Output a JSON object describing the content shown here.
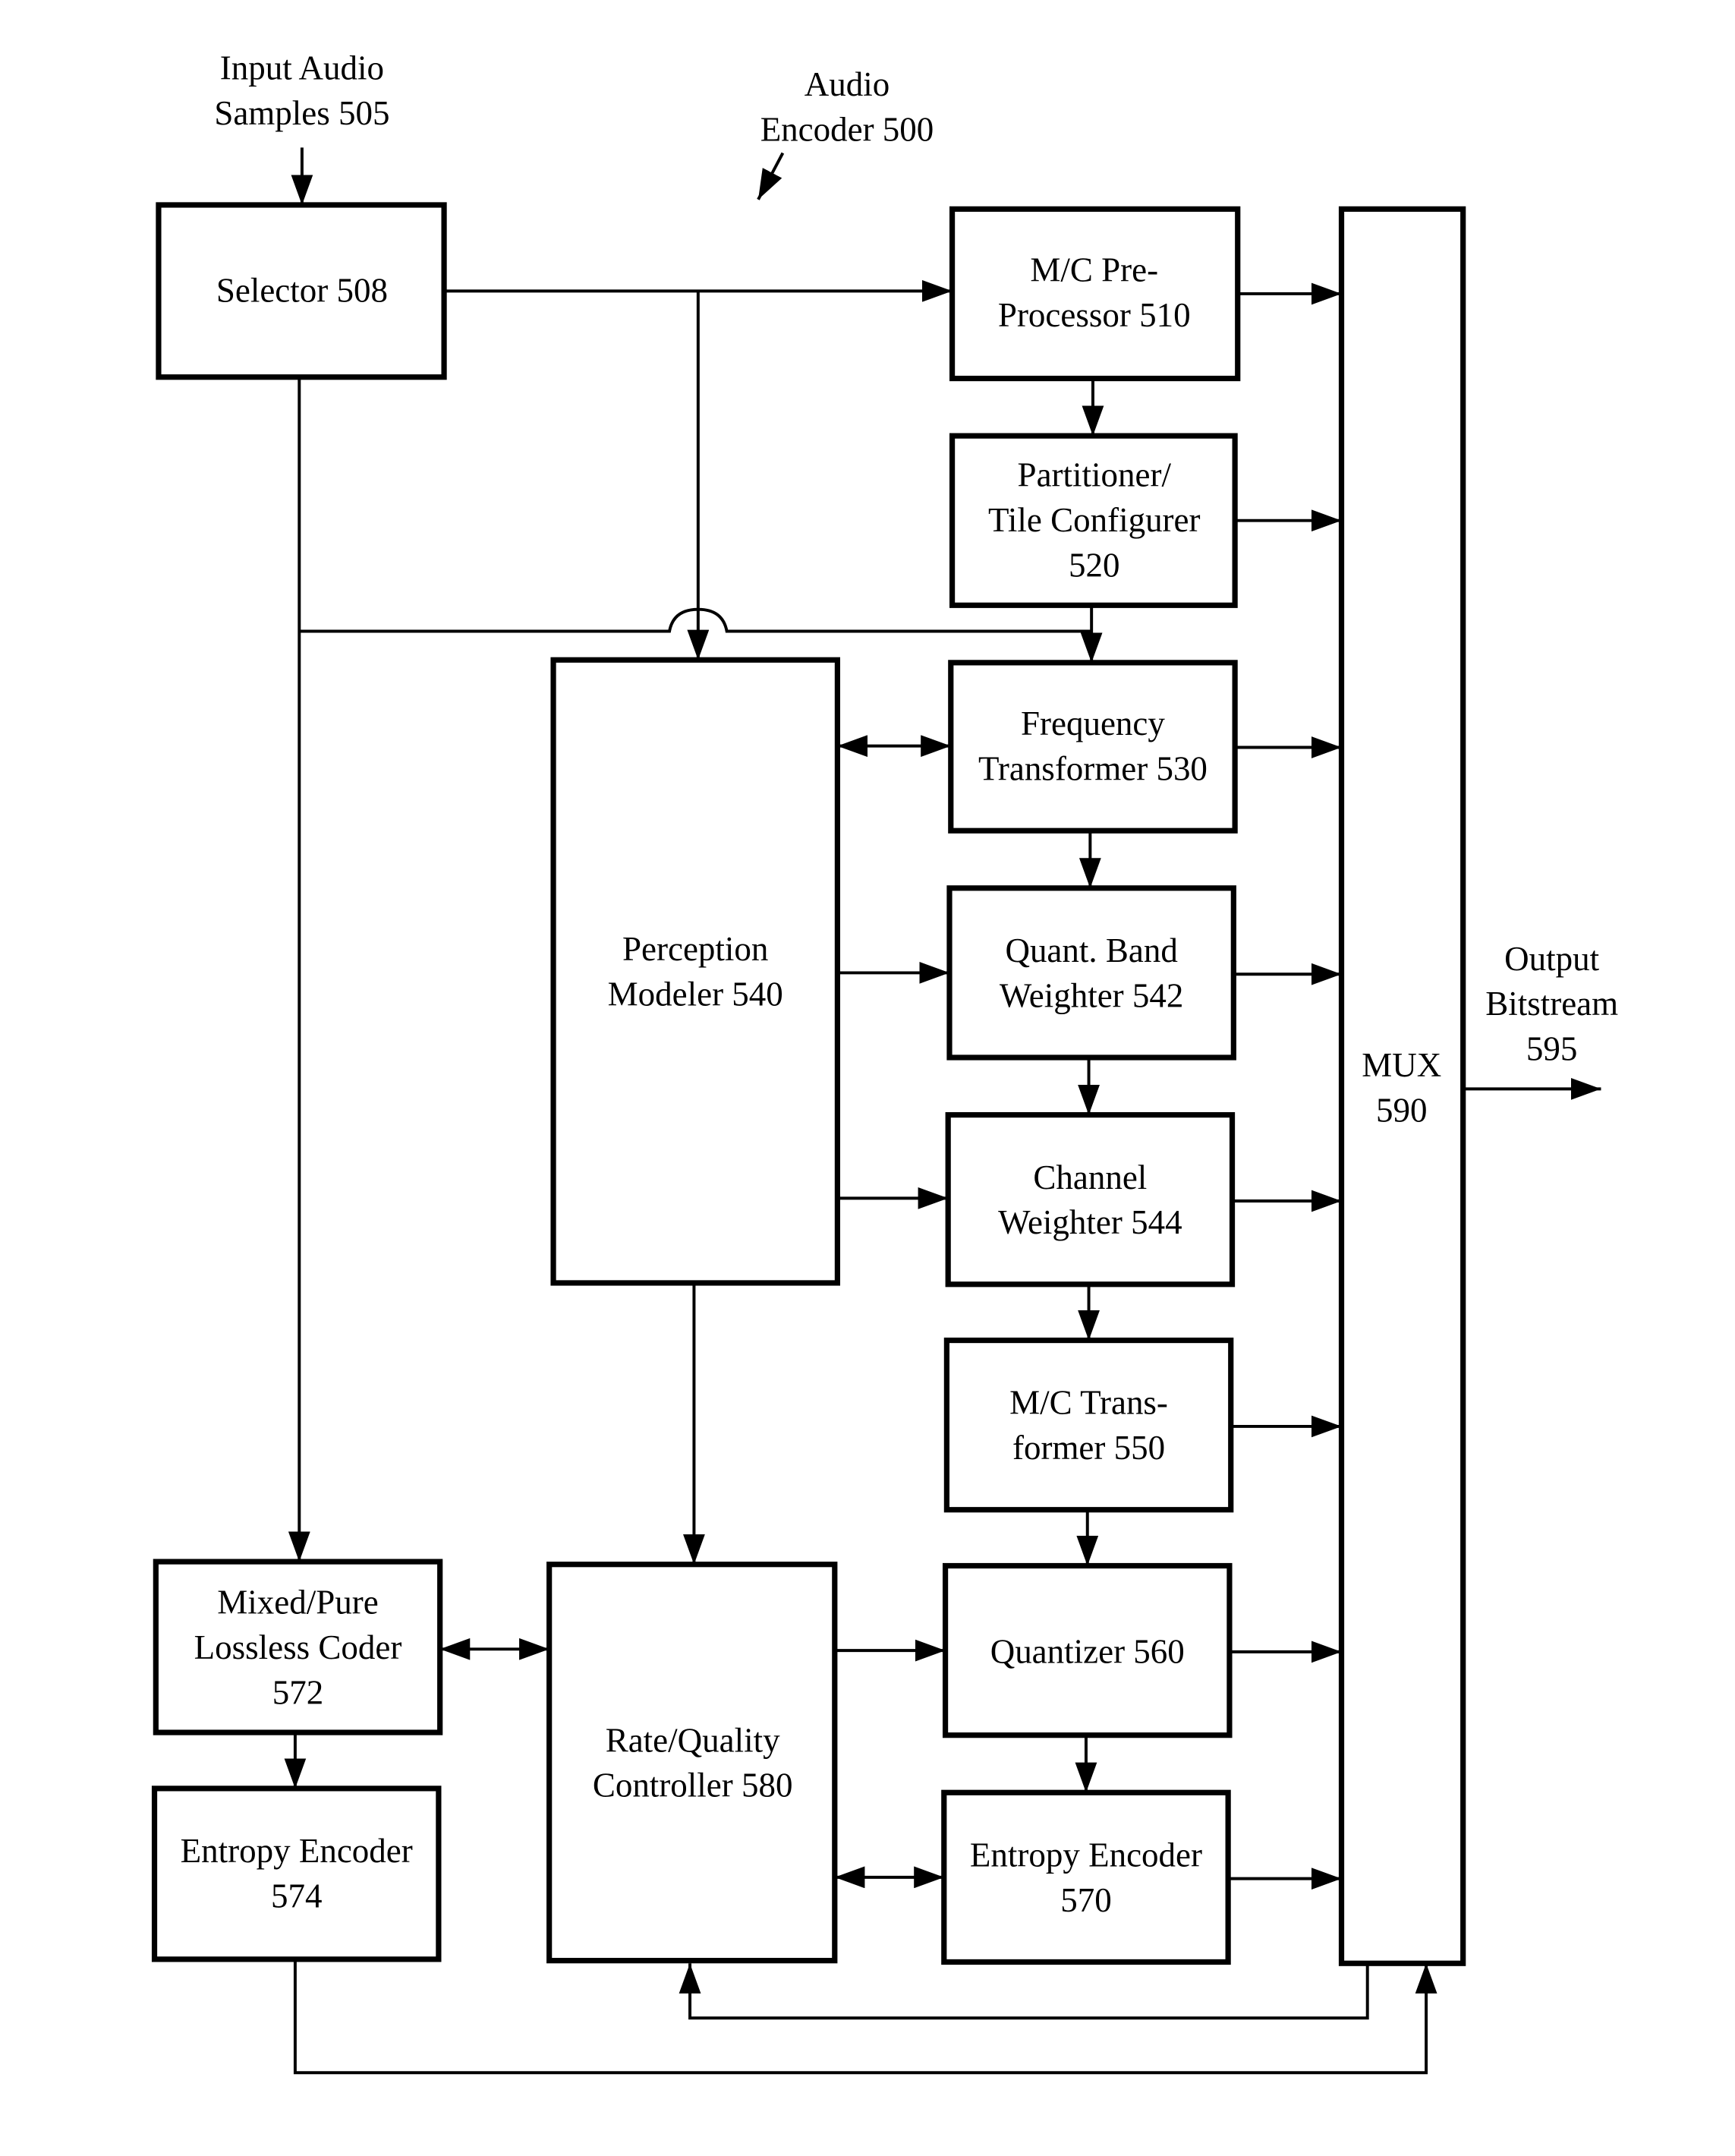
{
  "diagram": {
    "title": [
      "Audio",
      "Encoder 500"
    ],
    "input_label": [
      "Input Audio",
      "Samples 505"
    ],
    "output_label": [
      "Output",
      "Bitstream",
      "595"
    ],
    "blocks": {
      "selector": [
        "Selector 508"
      ],
      "mc_preprocessor": [
        "M/C Pre-",
        "Processor 510"
      ],
      "partitioner": [
        "Partitioner/",
        "Tile Configurer",
        "520"
      ],
      "freq_transformer": [
        "Frequency",
        "Transformer 530"
      ],
      "perception_modeler": [
        "Perception",
        "Modeler 540"
      ],
      "quant_band_weighter": [
        "Quant. Band",
        "Weighter 542"
      ],
      "channel_weighter": [
        "Channel",
        "Weighter 544"
      ],
      "mc_transformer": [
        "M/C Trans-",
        "former 550"
      ],
      "quantizer": [
        "Quantizer 560"
      ],
      "entropy_encoder_570": [
        "Entropy Encoder",
        "570"
      ],
      "lossless_coder": [
        "Mixed/Pure",
        "Lossless Coder",
        "572"
      ],
      "entropy_encoder_574": [
        "Entropy Encoder",
        "574"
      ],
      "rate_quality_controller": [
        "Rate/Quality",
        "Controller 580"
      ],
      "mux": [
        "MUX",
        "590"
      ]
    }
  }
}
